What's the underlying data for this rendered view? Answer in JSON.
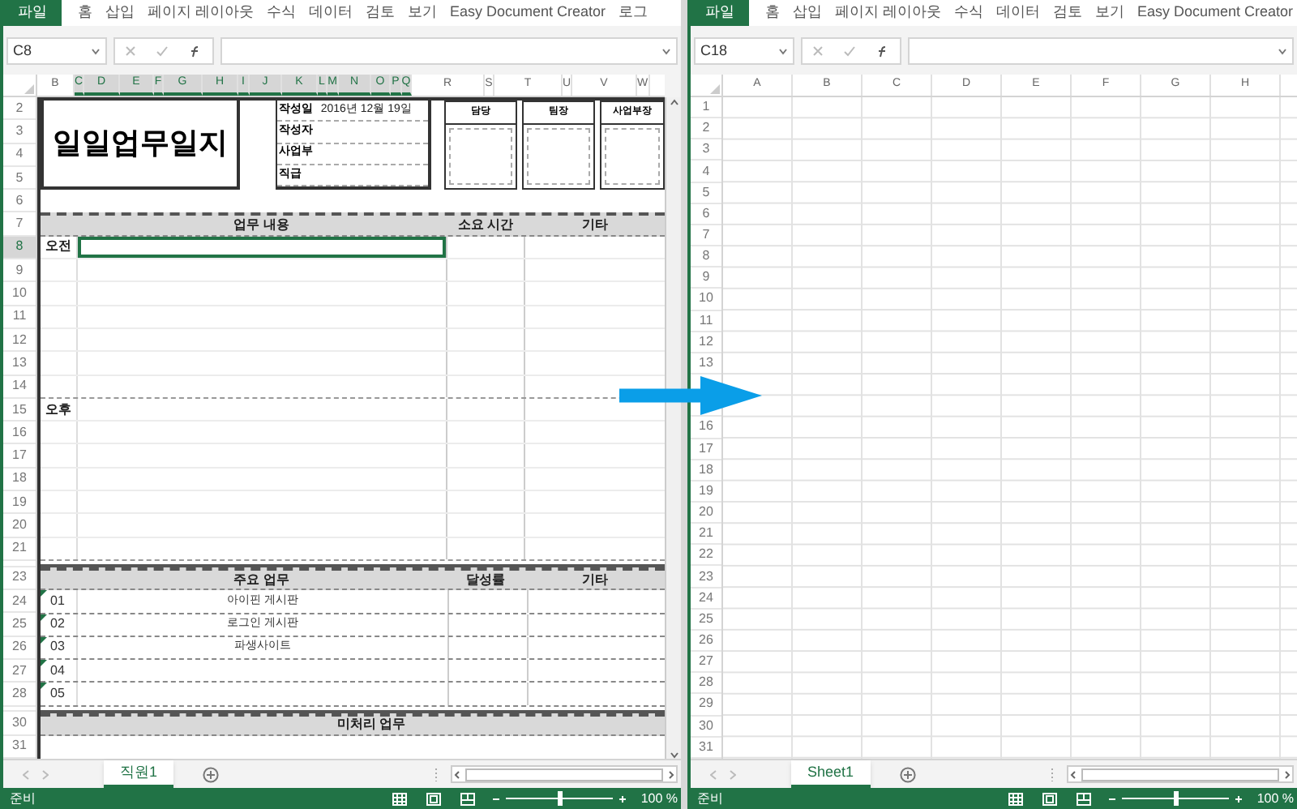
{
  "windows": [
    {
      "ribbon_tabs": [
        {
          "label": "파일",
          "selected": true
        },
        {
          "label": "홈",
          "selected": false
        },
        {
          "label": "삽입",
          "selected": false
        },
        {
          "label": "페이지 레이아웃",
          "selected": false
        },
        {
          "label": "수식",
          "selected": false
        },
        {
          "label": "데이터",
          "selected": false
        },
        {
          "label": "검토",
          "selected": false
        },
        {
          "label": "보기",
          "selected": false
        },
        {
          "label": "Easy Document Creator",
          "selected": false
        },
        {
          "label": "로그",
          "selected": false
        }
      ],
      "name_box": "C8",
      "columns": [
        {
          "label": "B",
          "selected": false
        },
        {
          "label": "C",
          "selected": true
        },
        {
          "label": "D",
          "selected": true
        },
        {
          "label": "E",
          "selected": true
        },
        {
          "label": "F",
          "selected": true
        },
        {
          "label": "G",
          "selected": true
        },
        {
          "label": "H",
          "selected": true
        },
        {
          "label": "I",
          "selected": true
        },
        {
          "label": "J",
          "selected": true
        },
        {
          "label": "K",
          "selected": true
        },
        {
          "label": "L",
          "selected": true
        },
        {
          "label": "M",
          "selected": true
        },
        {
          "label": "N",
          "selected": true
        },
        {
          "label": "O",
          "selected": true
        },
        {
          "label": "P",
          "selected": true
        },
        {
          "label": "Q",
          "selected": true
        },
        {
          "label": "R",
          "selected": false
        },
        {
          "label": "S",
          "selected": false
        },
        {
          "label": "T",
          "selected": false
        },
        {
          "label": "U",
          "selected": false
        },
        {
          "label": "V",
          "selected": false
        },
        {
          "label": "W",
          "selected": false
        }
      ],
      "rows": [
        {
          "label": "2",
          "selected": false
        },
        {
          "label": "3",
          "selected": false
        },
        {
          "label": "4",
          "selected": false
        },
        {
          "label": "5",
          "selected": false
        },
        {
          "label": "6",
          "selected": false
        },
        {
          "label": "7",
          "selected": false
        },
        {
          "label": "8",
          "selected": true
        },
        {
          "label": "9",
          "selected": false
        },
        {
          "label": "10",
          "selected": false
        },
        {
          "label": "11",
          "selected": false
        },
        {
          "label": "12",
          "selected": false
        },
        {
          "label": "13",
          "selected": false
        },
        {
          "label": "14",
          "selected": false
        },
        {
          "label": "15",
          "selected": false
        },
        {
          "label": "16",
          "selected": false
        },
        {
          "label": "17",
          "selected": false
        },
        {
          "label": "18",
          "selected": false
        },
        {
          "label": "19",
          "selected": false
        },
        {
          "label": "20",
          "selected": false
        },
        {
          "label": "21",
          "selected": false
        },
        {
          "label": "23",
          "selected": false
        },
        {
          "label": "24",
          "selected": false
        },
        {
          "label": "25",
          "selected": false
        },
        {
          "label": "26",
          "selected": false
        },
        {
          "label": "27",
          "selected": false
        },
        {
          "label": "28",
          "selected": false
        },
        {
          "label": "30",
          "selected": false
        },
        {
          "label": "31",
          "selected": false
        }
      ],
      "form": {
        "title": "일일업무일지",
        "info": [
          {
            "label": "작성일",
            "value": "2016년 12월 19일"
          },
          {
            "label": "작성자"
          },
          {
            "label": "사업부"
          },
          {
            "label": "직급"
          }
        ],
        "approvals": [
          "담당",
          "팀장",
          "사업부장"
        ],
        "daily": {
          "headers": [
            "업무 내용",
            "소요 시간",
            "기타"
          ],
          "periods": [
            {
              "label": "오전",
              "cell_selected": true
            },
            {
              "label": "오후",
              "cell_selected": false
            }
          ]
        },
        "tasks": {
          "headers": [
            "주요 업무",
            "달성률",
            "기타"
          ],
          "items": [
            {
              "number": "01",
              "task": "아이핀 게시판"
            },
            {
              "number": "02",
              "task": "로그인 게시판"
            },
            {
              "number": "03",
              "task": "파생사이트"
            },
            {
              "number": "04"
            },
            {
              "number": "05"
            }
          ]
        },
        "pending": {
          "header": "미처리 업무"
        }
      },
      "sheet_tabs": [
        {
          "label": "직원1",
          "selected": true
        }
      ],
      "status": "준비",
      "zoom": {
        "level": 0.5,
        "reading": "100 %"
      }
    },
    {
      "ribbon_tabs": [
        {
          "label": "파일",
          "selected": true
        },
        {
          "label": "홈",
          "selected": false
        },
        {
          "label": "삽입",
          "selected": false
        },
        {
          "label": "페이지 레이아웃",
          "selected": false
        },
        {
          "label": "수식",
          "selected": false
        },
        {
          "label": "데이터",
          "selected": false
        },
        {
          "label": "검토",
          "selected": false
        },
        {
          "label": "보기",
          "selected": false
        },
        {
          "label": "Easy Document Creator",
          "selected": false
        }
      ],
      "name_box": "C18",
      "columns": [
        {
          "label": "A",
          "selected": false
        },
        {
          "label": "B",
          "selected": false
        },
        {
          "label": "C",
          "selected": false
        },
        {
          "label": "D",
          "selected": false
        },
        {
          "label": "E",
          "selected": false
        },
        {
          "label": "F",
          "selected": false
        },
        {
          "label": "G",
          "selected": false
        },
        {
          "label": "H",
          "selected": false
        }
      ],
      "rows": [
        {
          "label": "1",
          "selected": false
        },
        {
          "label": "2",
          "selected": false
        },
        {
          "label": "3",
          "selected": false
        },
        {
          "label": "4",
          "selected": false
        },
        {
          "label": "5",
          "selected": false
        },
        {
          "label": "6",
          "selected": false
        },
        {
          "label": "7",
          "selected": false
        },
        {
          "label": "8",
          "selected": false
        },
        {
          "label": "9",
          "selected": false
        },
        {
          "label": "10",
          "selected": false
        },
        {
          "label": "11",
          "selected": false
        },
        {
          "label": "12",
          "selected": false
        },
        {
          "label": "13",
          "selected": false
        },
        {
          "selected": false
        },
        {
          "selected": false
        },
        {
          "label": "16",
          "selected": false
        },
        {
          "label": "17",
          "selected": false
        },
        {
          "label": "18",
          "selected": false
        },
        {
          "label": "19",
          "selected": false
        },
        {
          "label": "20",
          "selected": false
        },
        {
          "label": "21",
          "selected": false
        },
        {
          "label": "22",
          "selected": false
        },
        {
          "label": "23",
          "selected": false
        },
        {
          "label": "24",
          "selected": false
        },
        {
          "label": "25",
          "selected": false
        },
        {
          "label": "26",
          "selected": false
        },
        {
          "label": "27",
          "selected": false
        },
        {
          "label": "28",
          "selected": false
        },
        {
          "label": "29",
          "selected": false
        },
        {
          "label": "30",
          "selected": false
        },
        {
          "label": "31",
          "selected": false
        }
      ],
      "sheet_tabs": [
        {
          "label": "Sheet1",
          "selected": true
        }
      ],
      "status": "준비",
      "zoom": {
        "level": 0.5,
        "reading": "100 %"
      }
    }
  ]
}
